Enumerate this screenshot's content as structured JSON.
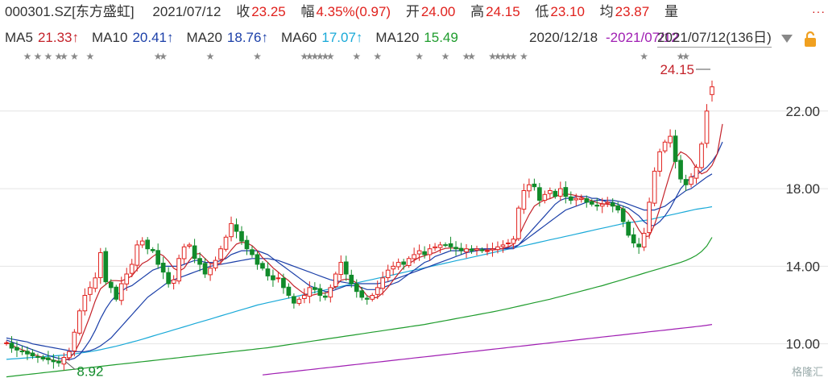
{
  "header": {
    "code": "000301.SZ[东方盛虹]",
    "date": "2021/07/12",
    "close_label": "收",
    "close_value": "23.25",
    "change_label": "幅",
    "change_value": "4.35%(0.97)",
    "open_label": "开",
    "open_value": "24.00",
    "high_label": "高",
    "high_value": "24.15",
    "low_label": "低",
    "low_value": "23.10",
    "avg_label": "均",
    "avg_value": "23.87",
    "vol_label": "量"
  },
  "ma_legend": [
    {
      "label": "MA5",
      "value": "21.33↑",
      "color": "#c4222a"
    },
    {
      "label": "MA10",
      "value": "20.41↑",
      "color": "#1b3fa8"
    },
    {
      "label": "MA20",
      "value": "18.76↑",
      "color": "#1b3fa8"
    },
    {
      "label": "MA60",
      "value": "17.07↑",
      "color": "#19a9d8"
    },
    {
      "label": "MA120",
      "value": "15.49",
      "color": "#1f9c2d"
    }
  ],
  "overlay": {
    "text1": "2020/12/18",
    "text2": "-2021/07/12"
  },
  "period": {
    "text": "2021/07/12(136日)"
  },
  "icons": {
    "dropdown": "triangle-down-icon",
    "lock": "lock-icon",
    "more": "more-dots-icon"
  },
  "chart_data": {
    "type": "candlestick",
    "ylim": [
      8.2,
      24.9
    ],
    "yticks": [
      {
        "value": 22,
        "label": "22.00"
      },
      {
        "value": 18,
        "label": "18.00"
      },
      {
        "value": 14,
        "label": "14.00"
      },
      {
        "value": 10,
        "label": "10.00"
      }
    ],
    "annotations": {
      "high": {
        "value": "24.15",
        "color": "#c4222a"
      },
      "low": {
        "value": "8.92",
        "color": "#118b2a"
      }
    },
    "colors": {
      "up": "#e0211d",
      "down": "#118b2a",
      "ma5": "#c4222a",
      "ma10": "#1b3fa8",
      "ma20": "#1b3fa8",
      "ma60": "#19a9d8",
      "ma120": "#1f9c2d",
      "ma250": "#a01fb3"
    },
    "closes": [
      10.05,
      9.78,
      9.68,
      9.62,
      9.48,
      9.38,
      9.3,
      9.22,
      9.18,
      9.08,
      9.02,
      9.3,
      9.6,
      10.6,
      11.7,
      12.5,
      12.9,
      13.4,
      14.7,
      13.2,
      12.9,
      12.3,
      13.1,
      13.6,
      14.1,
      15.1,
      15.3,
      14.9,
      14.8,
      14.1,
      13.7,
      13.1,
      13.3,
      14.4,
      15.0,
      15.1,
      14.4,
      14.1,
      13.6,
      13.9,
      14.3,
      14.9,
      15.5,
      16.2,
      15.8,
      15.3,
      14.9,
      14.6,
      14.1,
      13.9,
      13.5,
      13.3,
      13.4,
      12.9,
      12.5,
      12.1,
      12.3,
      12.5,
      12.9,
      12.8,
      12.5,
      12.4,
      12.9,
      13.6,
      14.2,
      13.6,
      13.1,
      12.7,
      12.4,
      12.3,
      12.5,
      12.9,
      13.4,
      13.8,
      14.0,
      14.2,
      14.1,
      14.4,
      14.6,
      14.8,
      14.6,
      14.9,
      15.0,
      15.1,
      15.1,
      15.0,
      14.9,
      14.8,
      14.9,
      14.8,
      14.9,
      14.8,
      14.8,
      14.9,
      15.0,
      15.1,
      15.2,
      15.4,
      17.0,
      17.9,
      18.2,
      18.1,
      17.4,
      17.7,
      17.9,
      17.6,
      18.0,
      17.6,
      17.4,
      17.5,
      17.5,
      17.3,
      17.2,
      17.1,
      17.2,
      17.3,
      17.1,
      16.9,
      16.3,
      15.6,
      15.2,
      15.0,
      15.7,
      17.3,
      18.9,
      19.9,
      20.4,
      20.7,
      19.4,
      18.5,
      18.2,
      18.6,
      19.1,
      20.3,
      22.0,
      23.25
    ],
    "ma5": [
      10.1,
      9.95,
      9.8,
      9.7,
      9.6,
      9.48,
      9.38,
      9.3,
      9.22,
      9.15,
      9.1,
      9.14,
      9.24,
      9.55,
      10.06,
      10.74,
      11.44,
      12.22,
      12.84,
      13.06,
      13.26,
      13.26,
      13.24,
      13.36,
      13.5,
      13.84,
      14.14,
      14.28,
      14.5,
      14.68,
      14.54,
      14.26,
      13.9,
      13.74,
      13.9,
      14.3,
      14.62,
      14.66,
      14.4,
      14.14,
      14.1,
      14.18,
      14.48,
      14.84,
      15.14,
      15.24,
      15.2,
      15.06,
      14.8,
      14.44,
      14.2,
      13.92,
      13.7,
      13.46,
      13.26,
      12.98,
      12.78,
      12.58,
      12.48,
      12.54,
      12.6,
      12.62,
      12.7,
      12.98,
      13.28,
      13.34,
      13.3,
      13.14,
      12.82,
      12.48,
      12.36,
      12.4,
      12.62,
      12.92,
      13.28,
      13.62,
      13.94,
      14.14,
      14.3,
      14.46,
      14.54,
      14.64,
      14.7,
      14.84,
      14.92,
      14.94,
      14.94,
      14.9,
      14.86,
      14.86,
      14.84,
      14.84,
      14.84,
      14.84,
      14.86,
      14.92,
      15.0,
      15.12,
      15.54,
      16.12,
      16.66,
      17.1,
      17.28,
      17.42,
      17.48,
      17.6,
      17.7,
      17.72,
      17.7,
      17.64,
      17.56,
      17.46,
      17.38,
      17.28,
      17.22,
      17.2,
      17.16,
      17.1,
      16.96,
      16.72,
      16.36,
      15.88,
      15.52,
      15.56,
      16.14,
      16.96,
      17.9,
      18.8,
      19.54,
      19.9,
      19.76,
      19.5,
      19.06,
      18.76,
      18.88,
      19.2,
      19.8,
      21.33
    ],
    "ma10": [
      10.2,
      10.1,
      10.0,
      9.9,
      9.8,
      9.7,
      9.6,
      9.5,
      9.4,
      9.32,
      9.25,
      9.2,
      9.18,
      9.25,
      9.45,
      9.8,
      10.2,
      10.7,
      11.3,
      11.8,
      12.2,
      12.5,
      12.7,
      12.9,
      13.0,
      13.2,
      13.4,
      13.6,
      13.8,
      13.9,
      14.0,
      14.0,
      14.0,
      14.0,
      14.1,
      14.2,
      14.3,
      14.3,
      14.2,
      14.2,
      14.2,
      14.3,
      14.4,
      14.6,
      14.7,
      14.8,
      14.8,
      14.8,
      14.8,
      14.7,
      14.6,
      14.4,
      14.2,
      14.0,
      13.8,
      13.6,
      13.4,
      13.2,
      13.0,
      12.9,
      12.8,
      12.7,
      12.7,
      12.8,
      12.9,
      13.0,
      13.0,
      13.0,
      12.9,
      12.8,
      12.8,
      12.8,
      12.9,
      13.0,
      13.1,
      13.2,
      13.4,
      13.6,
      13.8,
      14.0,
      14.2,
      14.3,
      14.5,
      14.6,
      14.7,
      14.8,
      14.8,
      14.8,
      14.8,
      14.9,
      14.9,
      14.9,
      14.9,
      14.9,
      14.9,
      14.9,
      14.9,
      14.9,
      15.1,
      15.4,
      15.7,
      16.0,
      16.3,
      16.6,
      16.9,
      17.2,
      17.4,
      17.5,
      17.5,
      17.6,
      17.6,
      17.6,
      17.5,
      17.5,
      17.4,
      17.3,
      17.3,
      17.2,
      17.1,
      17.0,
      16.8,
      16.6,
      16.3,
      16.1,
      16.1,
      16.3,
      16.6,
      17.0,
      17.5,
      18.0,
      18.3,
      18.6,
      18.7,
      18.9,
      19.1,
      19.4,
      19.8,
      20.41
    ],
    "ma20": [
      10.3,
      10.25,
      10.2,
      10.15,
      10.1,
      10.0,
      9.95,
      9.9,
      9.85,
      9.8,
      9.75,
      9.7,
      9.65,
      9.6,
      9.6,
      9.6,
      9.65,
      9.75,
      9.9,
      10.1,
      10.3,
      10.6,
      10.9,
      11.2,
      11.5,
      11.8,
      12.1,
      12.4,
      12.6,
      12.8,
      13.0,
      13.2,
      13.3,
      13.4,
      13.5,
      13.6,
      13.7,
      13.8,
      13.9,
      14.0,
      14.05,
      14.1,
      14.15,
      14.2,
      14.25,
      14.3,
      14.35,
      14.4,
      14.4,
      14.4,
      14.4,
      14.35,
      14.3,
      14.2,
      14.1,
      14.0,
      13.9,
      13.8,
      13.7,
      13.6,
      13.5,
      13.4,
      13.3,
      13.25,
      13.2,
      13.15,
      13.1,
      13.1,
      13.1,
      13.1,
      13.1,
      13.1,
      13.15,
      13.2,
      13.3,
      13.4,
      13.5,
      13.6,
      13.7,
      13.8,
      13.9,
      14.0,
      14.1,
      14.2,
      14.3,
      14.4,
      14.5,
      14.6,
      14.7,
      14.75,
      14.8,
      14.85,
      14.9,
      14.9,
      14.9,
      14.9,
      14.95,
      15.0,
      15.1,
      15.3,
      15.5,
      15.7,
      15.9,
      16.1,
      16.3,
      16.5,
      16.7,
      16.9,
      17.0,
      17.1,
      17.2,
      17.3,
      17.35,
      17.4,
      17.4,
      17.4,
      17.4,
      17.35,
      17.3,
      17.2,
      17.1,
      17.0,
      16.9,
      16.9,
      16.9,
      17.0,
      17.1,
      17.3,
      17.5,
      17.7,
      17.9,
      18.0,
      18.2,
      18.4,
      18.6,
      18.76
    ],
    "ma60": [
      9.2,
      9.22,
      9.24,
      9.26,
      9.28,
      9.3,
      9.32,
      9.34,
      9.36,
      9.38,
      9.4,
      9.42,
      9.45,
      9.48,
      9.52,
      9.56,
      9.6,
      9.65,
      9.7,
      9.76,
      9.82,
      9.88,
      9.95,
      10.02,
      10.09,
      10.16,
      10.24,
      10.32,
      10.4,
      10.48,
      10.56,
      10.64,
      10.72,
      10.8,
      10.88,
      10.96,
      11.04,
      11.12,
      11.2,
      11.28,
      11.36,
      11.44,
      11.52,
      11.6,
      11.68,
      11.76,
      11.84,
      11.92,
      12.0,
      12.06,
      12.12,
      12.18,
      12.24,
      12.3,
      12.36,
      12.42,
      12.48,
      12.54,
      12.6,
      12.66,
      12.72,
      12.78,
      12.84,
      12.9,
      12.96,
      13.02,
      13.08,
      13.14,
      13.2,
      13.26,
      13.32,
      13.38,
      13.44,
      13.5,
      13.56,
      13.62,
      13.68,
      13.74,
      13.8,
      13.86,
      13.92,
      13.98,
      14.04,
      14.1,
      14.16,
      14.22,
      14.28,
      14.34,
      14.4,
      14.46,
      14.52,
      14.58,
      14.64,
      14.7,
      14.76,
      14.82,
      14.88,
      14.94,
      15.0,
      15.06,
      15.12,
      15.18,
      15.24,
      15.3,
      15.36,
      15.42,
      15.48,
      15.54,
      15.6,
      15.66,
      15.72,
      15.78,
      15.84,
      15.9,
      15.96,
      16.02,
      16.08,
      16.14,
      16.2,
      16.24,
      16.28,
      16.32,
      16.36,
      16.4,
      16.46,
      16.52,
      16.58,
      16.64,
      16.7,
      16.76,
      16.82,
      16.88,
      16.94,
      16.98,
      17.02,
      17.07
    ],
    "ma120": [
      8.3,
      8.33,
      8.36,
      8.39,
      8.42,
      8.45,
      8.48,
      8.51,
      8.54,
      8.57,
      8.6,
      8.63,
      8.66,
      8.69,
      8.72,
      8.75,
      8.78,
      8.81,
      8.84,
      8.87,
      8.9,
      8.93,
      8.96,
      8.99,
      9.02,
      9.05,
      9.08,
      9.11,
      9.14,
      9.17,
      9.2,
      9.23,
      9.26,
      9.29,
      9.32,
      9.35,
      9.38,
      9.41,
      9.44,
      9.47,
      9.5,
      9.53,
      9.56,
      9.59,
      9.62,
      9.65,
      9.68,
      9.71,
      9.74,
      9.77,
      9.8,
      9.84,
      9.88,
      9.92,
      9.96,
      10.0,
      10.04,
      10.08,
      10.12,
      10.16,
      10.2,
      10.24,
      10.28,
      10.32,
      10.36,
      10.4,
      10.44,
      10.48,
      10.52,
      10.56,
      10.6,
      10.64,
      10.68,
      10.72,
      10.76,
      10.8,
      10.84,
      10.88,
      10.92,
      10.96,
      11.0,
      11.05,
      11.1,
      11.15,
      11.2,
      11.25,
      11.3,
      11.35,
      11.4,
      11.45,
      11.5,
      11.55,
      11.6,
      11.65,
      11.7,
      11.76,
      11.82,
      11.88,
      11.94,
      12.0,
      12.06,
      12.12,
      12.18,
      12.24,
      12.3,
      12.37,
      12.44,
      12.51,
      12.58,
      12.65,
      12.72,
      12.79,
      12.86,
      12.93,
      13.0,
      13.08,
      13.16,
      13.24,
      13.32,
      13.4,
      13.48,
      13.56,
      13.64,
      13.72,
      13.8,
      13.88,
      13.96,
      14.04,
      14.12,
      14.2,
      14.3,
      14.42,
      14.56,
      14.76,
      15.04,
      15.49
    ],
    "ma250": [
      null,
      null,
      null,
      null,
      null,
      null,
      null,
      null,
      null,
      null,
      null,
      null,
      null,
      null,
      null,
      null,
      null,
      null,
      null,
      null,
      null,
      null,
      null,
      null,
      null,
      null,
      null,
      null,
      null,
      null,
      null,
      null,
      null,
      null,
      null,
      null,
      null,
      null,
      null,
      null,
      null,
      null,
      null,
      null,
      null,
      null,
      null,
      null,
      null,
      8.4,
      8.43,
      8.46,
      8.49,
      8.52,
      8.55,
      8.58,
      8.61,
      8.64,
      8.67,
      8.7,
      8.73,
      8.76,
      8.79,
      8.82,
      8.85,
      8.88,
      8.91,
      8.94,
      8.97,
      9.0,
      9.03,
      9.06,
      9.09,
      9.12,
      9.15,
      9.18,
      9.21,
      9.24,
      9.27,
      9.3,
      9.33,
      9.36,
      9.39,
      9.42,
      9.45,
      9.48,
      9.51,
      9.54,
      9.57,
      9.6,
      9.63,
      9.66,
      9.69,
      9.72,
      9.75,
      9.78,
      9.81,
      9.84,
      9.87,
      9.9,
      9.93,
      9.96,
      9.99,
      10.02,
      10.05,
      10.08,
      10.11,
      10.14,
      10.17,
      10.2,
      10.23,
      10.26,
      10.29,
      10.32,
      10.35,
      10.38,
      10.41,
      10.44,
      10.47,
      10.5,
      10.53,
      10.56,
      10.59,
      10.62,
      10.65,
      10.68,
      10.71,
      10.74,
      10.77,
      10.8,
      10.83,
      10.86,
      10.89,
      10.92,
      10.96,
      11.0
    ]
  },
  "watermark": "格隆汇"
}
